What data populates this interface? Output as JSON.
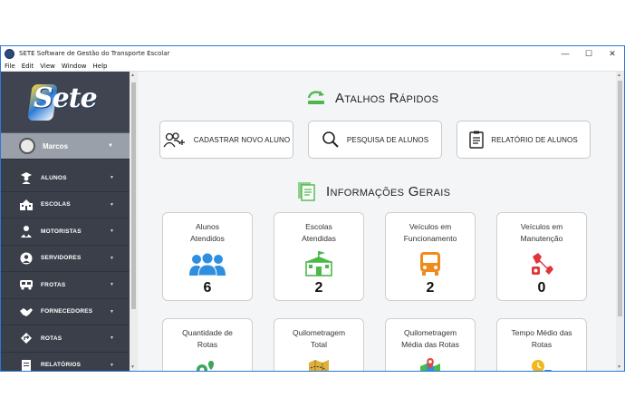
{
  "window": {
    "title": "SETE Software de Gestão do Transporte Escolar",
    "controls": [
      "—",
      "☐",
      "✕"
    ]
  },
  "menu": [
    "File",
    "Edit",
    "View",
    "Window",
    "Help"
  ],
  "sidebar": {
    "logo_text": "Sete",
    "user_name": "Marcos",
    "items": [
      {
        "label": "ALUNOS",
        "icon": "student-icon"
      },
      {
        "label": "ESCOLAS",
        "icon": "school-icon"
      },
      {
        "label": "MOTORISTAS",
        "icon": "driver-icon"
      },
      {
        "label": "SERVIDORES",
        "icon": "staff-icon"
      },
      {
        "label": "FROTAS",
        "icon": "bus-icon"
      },
      {
        "label": "FORNECEDORES",
        "icon": "supplier-icon"
      },
      {
        "label": "ROTAS",
        "icon": "route-icon"
      },
      {
        "label": "RELATÓRIOS",
        "icon": "report-icon"
      }
    ]
  },
  "quick": {
    "title": "Atalhos Rápidos",
    "buttons": [
      {
        "label": "CADASTRAR NOVO ALUNO",
        "icon": "add-user-icon"
      },
      {
        "label": "PESQUISA DE ALUNOS",
        "icon": "search-icon"
      },
      {
        "label": "RELATÓRIO DE ALUNOS",
        "icon": "clipboard-icon"
      }
    ]
  },
  "info": {
    "title": "Informações Gerais",
    "cards": [
      {
        "line1": "Alunos",
        "line2": "Atendidos",
        "value": "6",
        "icon": "students-group-icon",
        "color": "#2e8fe0"
      },
      {
        "line1": "Escolas",
        "line2": "Atendidas",
        "value": "2",
        "icon": "school-building-icon",
        "color": "#4cb84a"
      },
      {
        "line1": "Veículos em",
        "line2": "Funcionamento",
        "value": "2",
        "icon": "bus-front-icon",
        "color": "#f08a1c"
      },
      {
        "line1": "Veículos em",
        "line2": "Manutenção",
        "value": "0",
        "icon": "wrench-icon",
        "color": "#e0343a"
      },
      {
        "line1": "Quantidade de",
        "line2": "Rotas",
        "value": "",
        "icon": "route-pin-icon",
        "color": "#3aa65a"
      },
      {
        "line1": "Quilometragem",
        "line2": "Total",
        "value": "",
        "icon": "map-icon",
        "color": "#e0b13a"
      },
      {
        "line1": "Quilometragem",
        "line2": "Média das Rotas",
        "value": "",
        "icon": "map-marker-icon",
        "color": "#e04a3a"
      },
      {
        "line1": "Tempo Médio das",
        "line2": "Rotas",
        "value": "",
        "icon": "clock-icon",
        "color": "#f0b81c"
      }
    ]
  }
}
